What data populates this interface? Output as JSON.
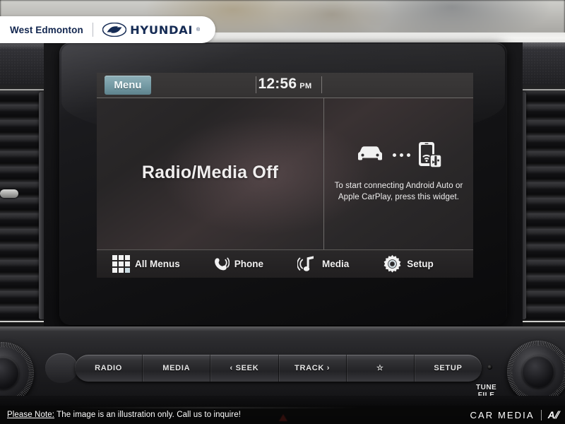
{
  "dealer_badge": {
    "name": "West Edmonton",
    "brand": "HYUNDAI",
    "registered_mark": "®",
    "logo_icon": "hyundai-h-logo"
  },
  "infotainment": {
    "status_bar": {
      "menu_button_label": "Menu",
      "clock_time": "12:56",
      "clock_ampm": "PM"
    },
    "left_pane": {
      "status_text": "Radio/Media Off"
    },
    "right_pane": {
      "widget_text": "To start connecting Android Auto or Apple CarPlay, press this widget.",
      "icons": [
        "car-icon",
        "ellipsis-dots-icon",
        "phone-usb-widget-icon"
      ]
    },
    "taskbar": [
      {
        "label": "All Menus",
        "icon": "grid-3x3-icon"
      },
      {
        "label": "Phone",
        "icon": "phone-handset-icon"
      },
      {
        "label": "Media",
        "icon": "music-note-icon"
      },
      {
        "label": "Setup",
        "icon": "gear-icon"
      }
    ]
  },
  "hard_buttons": [
    {
      "label": "RADIO",
      "icon": ""
    },
    {
      "label": "MEDIA",
      "icon": ""
    },
    {
      "label": "‹ SEEK",
      "icon": "seek-back-icon"
    },
    {
      "label": "TRACK ›",
      "icon": "track-forward-icon"
    },
    {
      "label": "☆",
      "icon": "star-favorite-icon"
    },
    {
      "label": "SETUP",
      "icon": ""
    }
  ],
  "knobs": {
    "right_label_line1": "TUNE",
    "right_label_line2": "FILE",
    "right_knob_icon": "tune-file-knob",
    "left_knob_icon": "volume-power-knob"
  },
  "footer": {
    "note_lead": "Please Note:",
    "note_body": " The image is an illustration only. Call us to inquire!",
    "watermark_word": "CAR MEDIA",
    "watermark_mark": "A⫽"
  },
  "colors": {
    "menu_button": "#749aa4",
    "screen_text": "#f0eeee",
    "badge_text": "#12264f",
    "accent_dark": "#1a1a1b"
  }
}
